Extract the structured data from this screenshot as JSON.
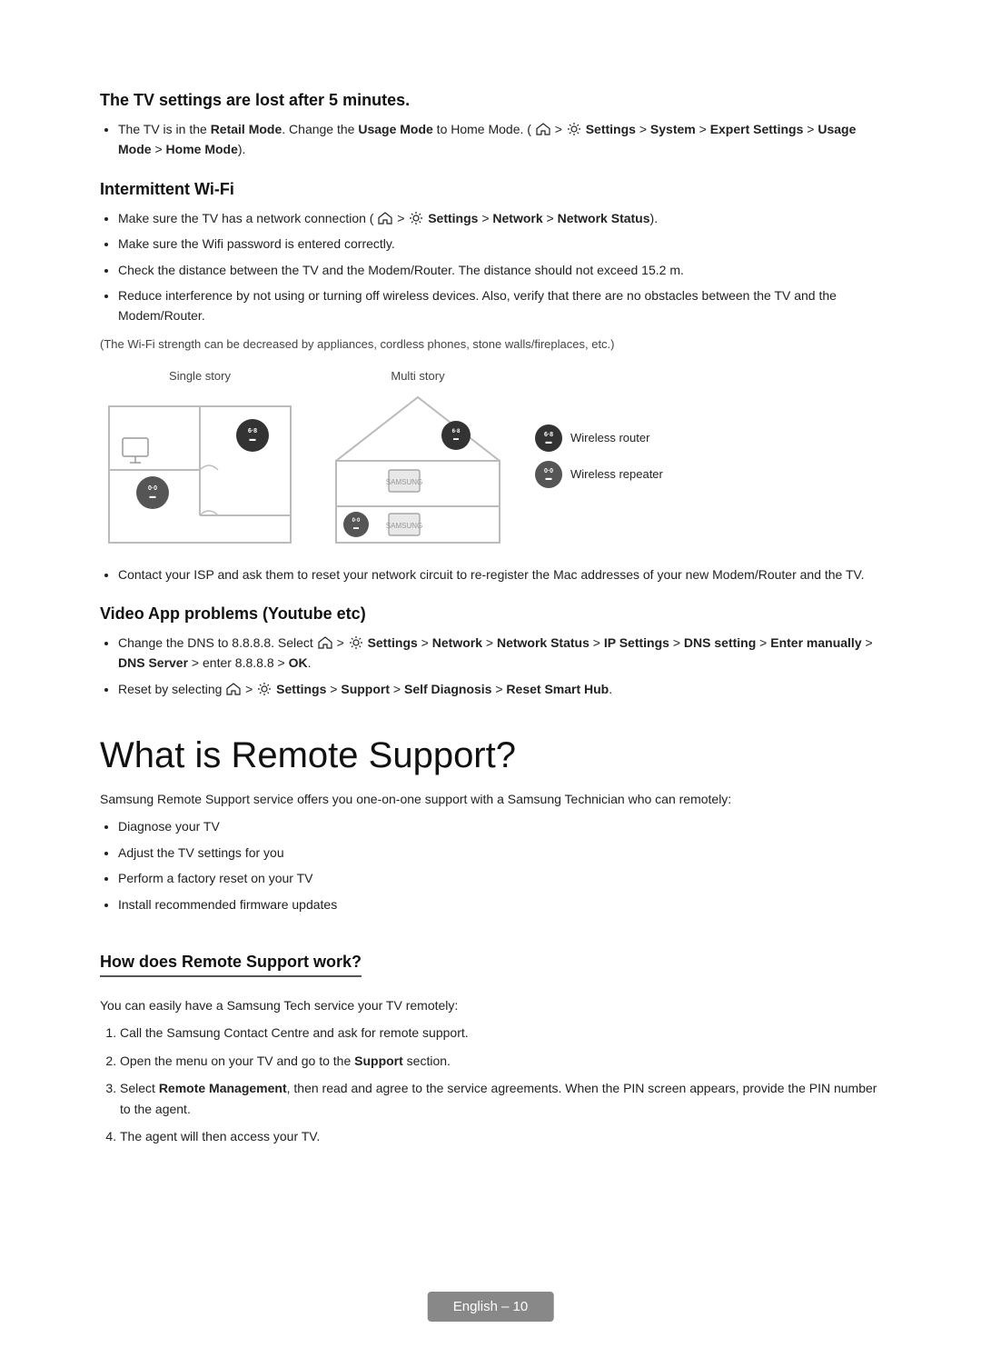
{
  "sections": {
    "tv_settings_lost": {
      "heading": "The TV settings are lost after 5 minutes.",
      "bullet": "The TV is in the",
      "retail_mode": "Retail Mode",
      "change_usage": ". Change the",
      "usage_mode": "Usage Mode",
      "to": " to Home Mode. (",
      "nav1": "Settings",
      "nav2": "System",
      "nav3": "Expert Settings",
      "nav4": "Usage Mode",
      "nav5": "Home Mode",
      "end": ")."
    },
    "intermittent_wifi": {
      "heading": "Intermittent Wi-Fi",
      "bullets": [
        "Make sure the TV has a network connection (",
        "Make sure the Wifi password is entered correctly.",
        "Check the distance between the TV and the Modem/Router. The distance should not exceed 15.2 m.",
        "Reduce interference by not using or turning off wireless devices. Also, verify that there are no obstacles between the TV and the Modem/Router."
      ],
      "bullet1_bold": "Settings",
      "bullet1_nav": "Network",
      "bullet1_nav2": "Network Status",
      "note": "(The Wi-Fi strength can be decreased by appliances, cordless phones, stone walls/fireplaces, etc.)",
      "single_story_label": "Single story",
      "multi_story_label": "Multi story",
      "legend_router": "Wireless router",
      "legend_repeater": "Wireless repeater",
      "contact_bullet": "Contact your ISP and ask them to reset your network circuit to re-register the Mac addresses of your new Modem/Router and the TV."
    },
    "video_app": {
      "heading": "Video App problems (Youtube etc)",
      "bullet1_prefix": "Change the DNS to 8.8.8.8. Select",
      "bullet1_nav": "Settings",
      "bullet1_nav2": "Network",
      "bullet1_nav3": "Network Status",
      "bullet1_nav4": "IP Settings",
      "bullet1_nav5": "DNS setting",
      "bullet1_nav6": "Enter manually",
      "bullet1_nav7": "DNS Server",
      "bullet1_suffix": " enter 8.8.8.8 >",
      "bullet1_ok": "OK",
      "bullet2_prefix": "Reset by selecting",
      "bullet2_nav": "Settings",
      "bullet2_nav2": "Support",
      "bullet2_nav3": "Self Diagnosis",
      "bullet2_nav4": "Reset Smart Hub",
      "bullet2_end": "."
    },
    "remote_support": {
      "heading": "What is Remote Support?",
      "intro": "Samsung Remote Support service offers you one-on-one support with a Samsung Technician who can remotely:",
      "bullets": [
        "Diagnose your TV",
        "Adjust the TV settings for you",
        "Perform a factory reset on your TV",
        "Install recommended firmware updates"
      ]
    },
    "how_remote": {
      "heading": "How does Remote Support work?",
      "intro": "You can easily have a Samsung Tech service your TV remotely:",
      "steps": [
        "Call the Samsung Contact Centre and ask for remote support.",
        "Open the menu on your TV and go to the",
        "Select",
        "The agent will then access your TV."
      ],
      "step2_bold": "Support",
      "step2_end": " section.",
      "step3_bold": "Remote Management",
      "step3_end": ", then read and agree to the service agreements. When the PIN screen appears, provide the PIN number to the agent."
    }
  },
  "footer": {
    "label": "English – 10"
  }
}
